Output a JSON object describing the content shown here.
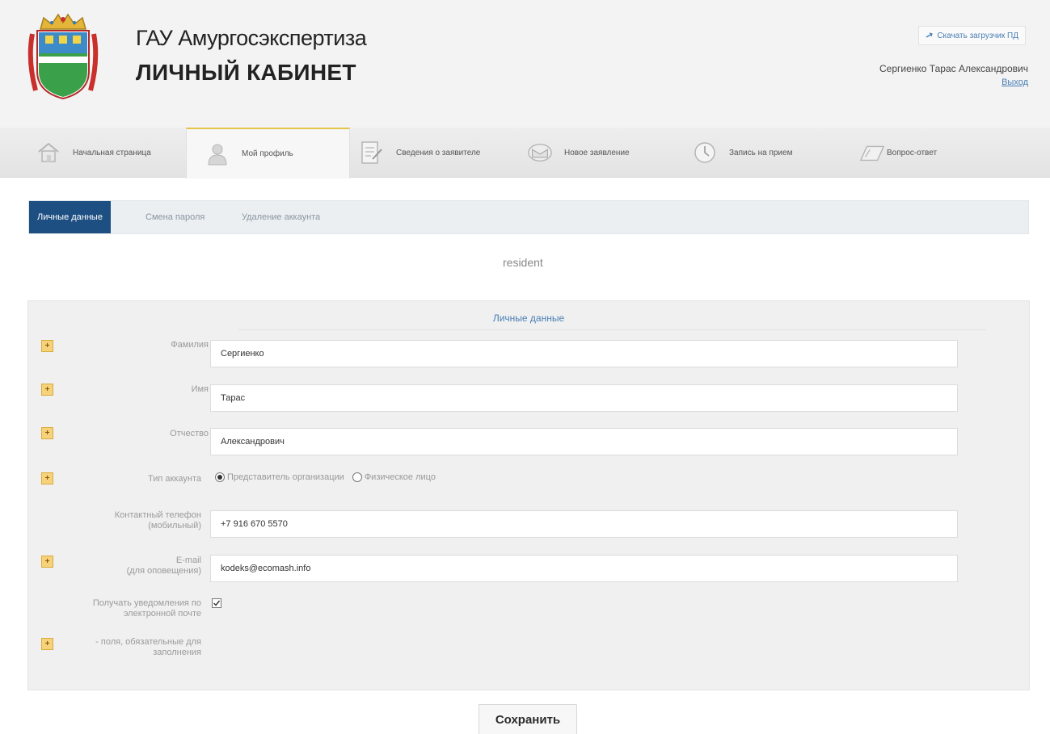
{
  "header": {
    "org_name": "ГАУ Амургосэкспертиза",
    "cabinet_title": "ЛИЧНЫЙ КАБИНЕТ",
    "download_label": "Скачать загрузчик ПД",
    "user_name": "Сергиенко Тарас Александрович",
    "logout_label": "Выход"
  },
  "nav": {
    "items": [
      {
        "label": "Начальная страница",
        "icon": "home-icon"
      },
      {
        "label": "Мой профиль",
        "icon": "user-icon"
      },
      {
        "label": "Сведения о заявителе",
        "icon": "document-edit-icon"
      },
      {
        "label": "Новое заявление",
        "icon": "envelope-icon"
      },
      {
        "label": "Запись на прием",
        "icon": "clock-icon"
      },
      {
        "label": "Вопрос-ответ",
        "icon": "question-icon"
      }
    ],
    "active": "Мой профиль"
  },
  "tabs": [
    {
      "label": "Личные данные"
    },
    {
      "label": "Смена пароля"
    },
    {
      "label": "Удаление аккаунта"
    }
  ],
  "role": "resident",
  "form": {
    "title": "Личные данные",
    "last_name_label": "Фамилия",
    "last_name_value": "Сергиенко",
    "first_name_label": "Имя",
    "first_name_value": "Тарас",
    "patronymic_label": "Отчество",
    "patronymic_value": "Александрович",
    "account_type_label": "Тип аккаунта",
    "account_type_option_org": "Представитель организации",
    "account_type_option_person": "Физическое лицо",
    "account_type_selected": "Представитель организации",
    "phone_label_line1": "Контактный телефон",
    "phone_label_line2": "(мобильный)",
    "phone_value": "+7 916 670 5570",
    "email_label_line1": "E-mail",
    "email_label_line2": "(для оповещения)",
    "email_value": "kodeks@ecomash.info",
    "notify_label_line1": "Получать уведомления по",
    "notify_label_line2": "электронной почте",
    "notify_checked": true,
    "required_note_line1": "- поля, обязательные для",
    "required_note_line2": "заполнения"
  },
  "save_label": "Сохранить",
  "colors": {
    "tab_active_bg": "#1e4f82",
    "link": "#4a7fb5",
    "required_marker": "#f6d27a",
    "nav_active_accent": "#e3c44a"
  }
}
